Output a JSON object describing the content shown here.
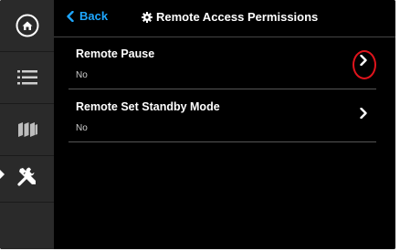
{
  "header": {
    "back_label": "Back",
    "title": "Remote Access Permissions",
    "accent_color": "#1ea7ff"
  },
  "sidebar": {
    "items": [
      {
        "icon": "home-icon"
      },
      {
        "icon": "list-icon"
      },
      {
        "icon": "panels-icon"
      },
      {
        "icon": "tools-icon",
        "active": true
      },
      {
        "icon": "empty"
      }
    ]
  },
  "settings": [
    {
      "label": "Remote Pause",
      "value": "No",
      "highlighted": true
    },
    {
      "label": "Remote Set Standby Mode",
      "value": "No"
    }
  ],
  "colors": {
    "highlight_ring": "#e0141c",
    "sidebar_bg": "#2a2a2a",
    "main_bg": "#000000"
  }
}
